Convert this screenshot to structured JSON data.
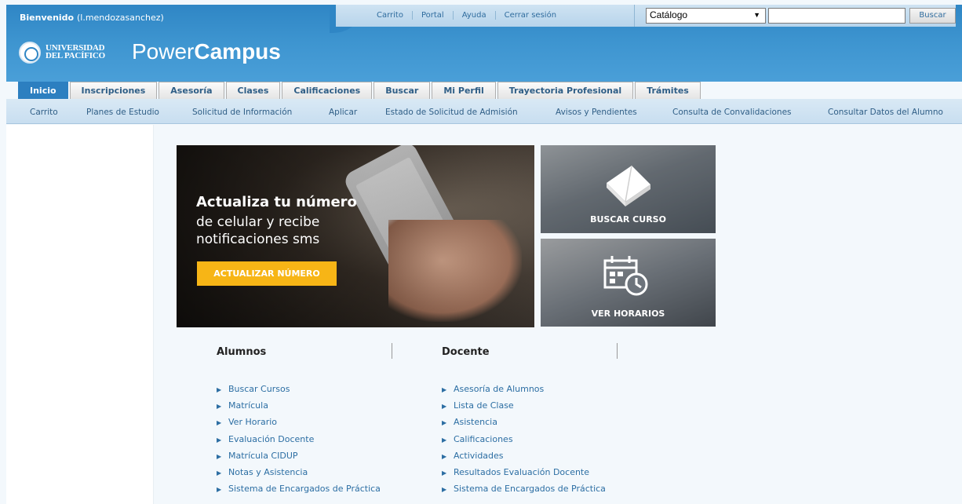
{
  "header": {
    "welcome_label": "Bienvenido",
    "username": "(l.mendozasanchez)",
    "top_links": [
      "Carrito",
      "Portal",
      "Ayuda",
      "Cerrar sesión"
    ],
    "catalog_select": "Catálogo",
    "search_button": "Buscar",
    "logo_text_line1": "UNIVERSIDAD",
    "logo_text_line2": "DEL PACÍFICO",
    "brand_light": "Power",
    "brand_bold": "Campus"
  },
  "tabs": [
    "Inicio",
    "Inscripciones",
    "Asesoría",
    "Clases",
    "Calificaciones",
    "Buscar",
    "Mi Perfil",
    "Trayectoria Profesional",
    "Trámites"
  ],
  "subnav": [
    "Carrito",
    "Planes de Estudio",
    "Solicitud de Información",
    "Aplicar",
    "Estado de Solicitud de Admisión",
    "Avisos y Pendientes",
    "Consulta de Convalidaciones",
    "Consultar Datos del Alumno"
  ],
  "hero": {
    "title": "Actualiza tu número",
    "subtitle": "de celular y recibe notificaciones sms",
    "button": "ACTUALIZAR NÚMERO"
  },
  "tiles": {
    "buscar": "BUSCAR CURSO",
    "horarios": "VER HORARIOS"
  },
  "alumnos": {
    "heading": "Alumnos",
    "links": [
      "Buscar Cursos",
      "Matrícula",
      "Ver Horario",
      "Evaluación Docente",
      "Matrícula CIDUP",
      "Notas y Asistencia",
      "Sistema de Encargados de Práctica"
    ]
  },
  "docente": {
    "heading": "Docente",
    "links": [
      "Asesoría de Alumnos",
      "Lista de Clase",
      "Asistencia",
      "Calificaciones",
      "Actividades",
      "Resultados Evaluación Docente",
      "Sistema de Encargados de Práctica"
    ]
  },
  "icons": {
    "bullet": "triangle-right",
    "book": "book-icon",
    "calendar": "calendar-clock-icon"
  },
  "colors": {
    "header_blue": "#3e95d0",
    "active_tab": "#2c7fc0",
    "hero_button": "#f7b516",
    "link": "#2c6ea3"
  }
}
